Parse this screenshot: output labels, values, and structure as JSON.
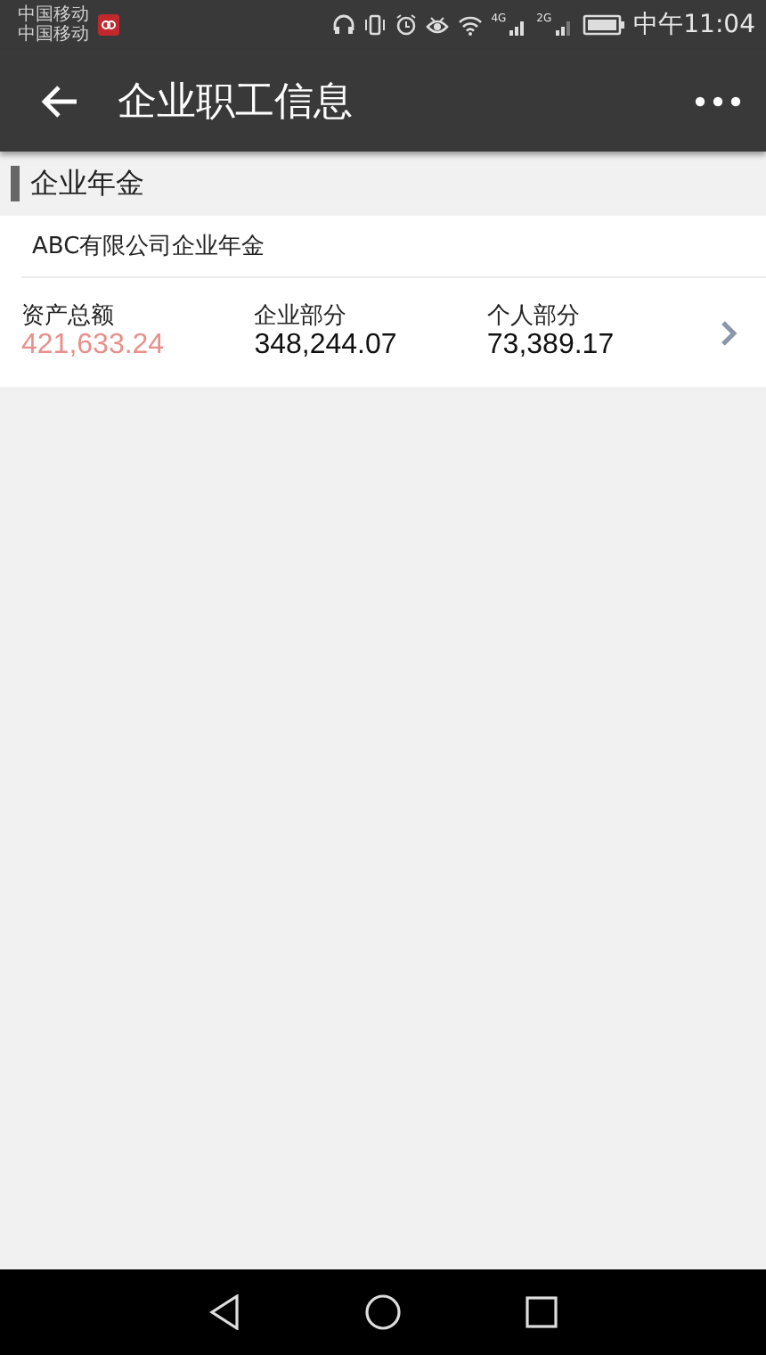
{
  "status_bar": {
    "carriers": [
      "中国移动",
      "中国移动"
    ],
    "network_labels": [
      "4G",
      "2G"
    ],
    "time": "中午11:04"
  },
  "toolbar": {
    "title": "企业职工信息"
  },
  "section": {
    "title": "企业年金"
  },
  "plan": {
    "name": "ABC有限公司企业年金",
    "metrics": [
      {
        "label": "资产总额",
        "value": "421,633.24",
        "color": "#e8908a"
      },
      {
        "label": "企业部分",
        "value": "348,244.07",
        "color": "#111111"
      },
      {
        "label": "个人部分",
        "value": "73,389.17",
        "color": "#111111"
      }
    ]
  }
}
